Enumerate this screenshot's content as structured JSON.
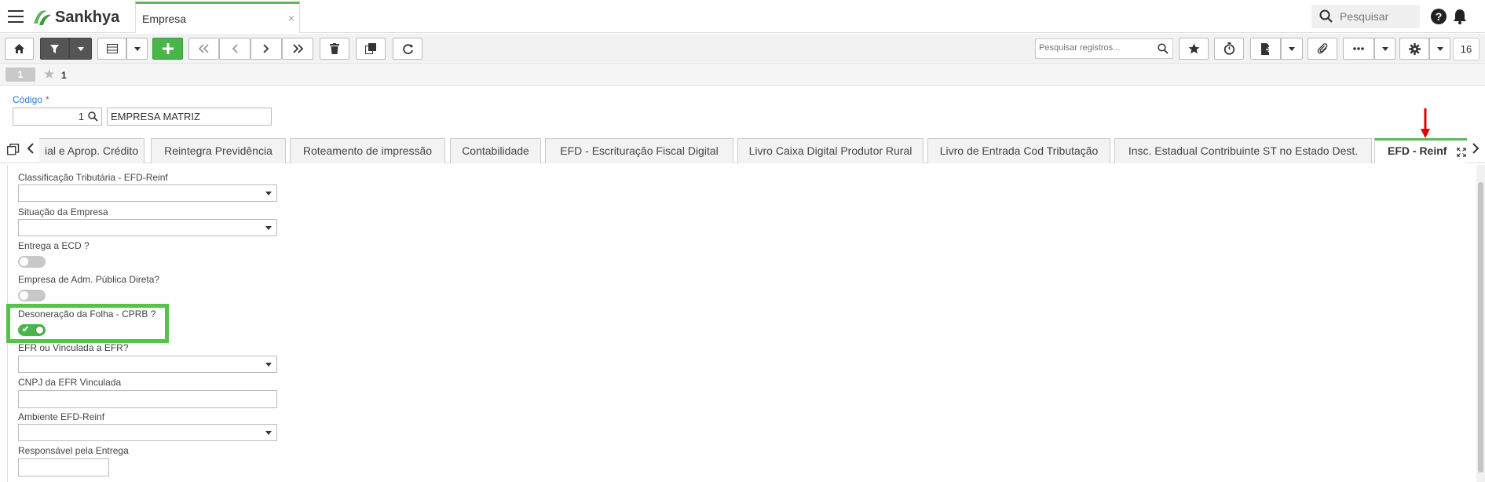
{
  "topbar": {
    "app_name": "Sankhya",
    "tab_title": "Empresa",
    "tab_close": "×",
    "search_placeholder": "Pesquisar",
    "help": "?"
  },
  "toolbar": {
    "search_placeholder": "Pesquisar registros...",
    "record_count": "16"
  },
  "record_bar": {
    "badge": "1",
    "record_number": "1"
  },
  "header": {
    "codigo_label": "Código",
    "required_mark": "*",
    "codigo_value": "1",
    "description": "EMPRESA MATRIZ"
  },
  "tabs": [
    {
      "label": "ial e Aprop. Crédito"
    },
    {
      "label": "Reintegra Previdência"
    },
    {
      "label": "Roteamento de impressão"
    },
    {
      "label": "Contabilidade"
    },
    {
      "label": "EFD - Escrituração Fiscal Digital"
    },
    {
      "label": "Livro Caixa Digital Produtor Rural"
    },
    {
      "label": "Livro de Entrada Cod Tributação"
    },
    {
      "label": "Insc. Estadual Contribuinte ST no Estado Dest."
    },
    {
      "label": "EFD - Reinf",
      "active": true
    }
  ],
  "fields": {
    "classificacao": {
      "label": "Classificação Tributária - EFD-Reinf",
      "value": ""
    },
    "situacao": {
      "label": "Situação da Empresa",
      "value": ""
    },
    "entrega_ecd": {
      "label": "Entrega a ECD ?",
      "on": false
    },
    "adm_publica": {
      "label": "Empresa de Adm. Pública Direta?",
      "on": false
    },
    "desoneracao": {
      "label": "Desoneração da Folha - CPRB ?",
      "on": true
    },
    "efr": {
      "label": "EFR ou Vinculada a EFR?",
      "value": ""
    },
    "cnpj_efr": {
      "label": "CNPJ da EFR Vinculada",
      "value": ""
    },
    "ambiente": {
      "label": "Ambiente EFD-Reinf",
      "value": ""
    },
    "responsavel": {
      "label": "Responsável pela Entrega",
      "value": ""
    }
  },
  "colors": {
    "accent_green": "#5cb85c",
    "highlight_green": "#55c24a",
    "annotation_red": "#e00000",
    "link_blue": "#2b7bd2"
  }
}
